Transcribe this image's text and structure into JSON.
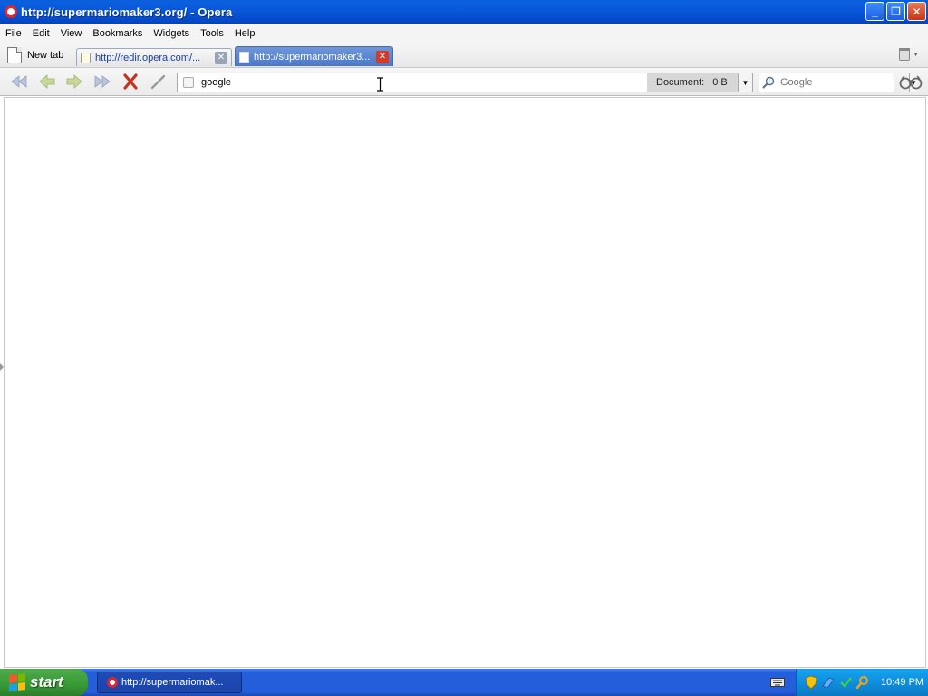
{
  "window": {
    "title": "http://supermariomaker3.org/ - Opera",
    "buttons": {
      "minimize": "_",
      "maximize": "❐",
      "close": "✕"
    }
  },
  "menubar": {
    "items": [
      "File",
      "Edit",
      "View",
      "Bookmarks",
      "Widgets",
      "Tools",
      "Help"
    ]
  },
  "tabbar": {
    "new_tab_label": "New tab",
    "tabs": [
      {
        "label": "http://redir.opera.com/...",
        "active": false
      },
      {
        "label": "http://supermariomaker3...",
        "active": true
      }
    ],
    "close_glyph": "✕"
  },
  "toolbar": {
    "address_value": "google",
    "document_label": "Document:",
    "document_size": "0 B",
    "search_placeholder": "Google",
    "dropdown_glyph": "▼"
  },
  "taskbar": {
    "start_label": "start",
    "task_item_label": "http://supermariomak...",
    "clock": "10:49 PM"
  },
  "colors": {
    "titlebar": "#0757d8",
    "active_tab": "#4b78c8",
    "close_red": "#d23a2a",
    "start_green": "#379a35",
    "tray_blue": "#0f8ad8"
  },
  "icons": [
    "opera-logo-icon",
    "rewind-icon",
    "back-icon",
    "forward-icon",
    "fast-forward-icon",
    "stop-icon",
    "edit-pencil-icon",
    "search-magnifier-icon",
    "zoom-glasses-icon",
    "trash-icon",
    "keyboard-icon",
    "shield-icon",
    "network-icon",
    "safely-remove-icon",
    "search-tray-icon",
    "windows-flag-icon"
  ]
}
